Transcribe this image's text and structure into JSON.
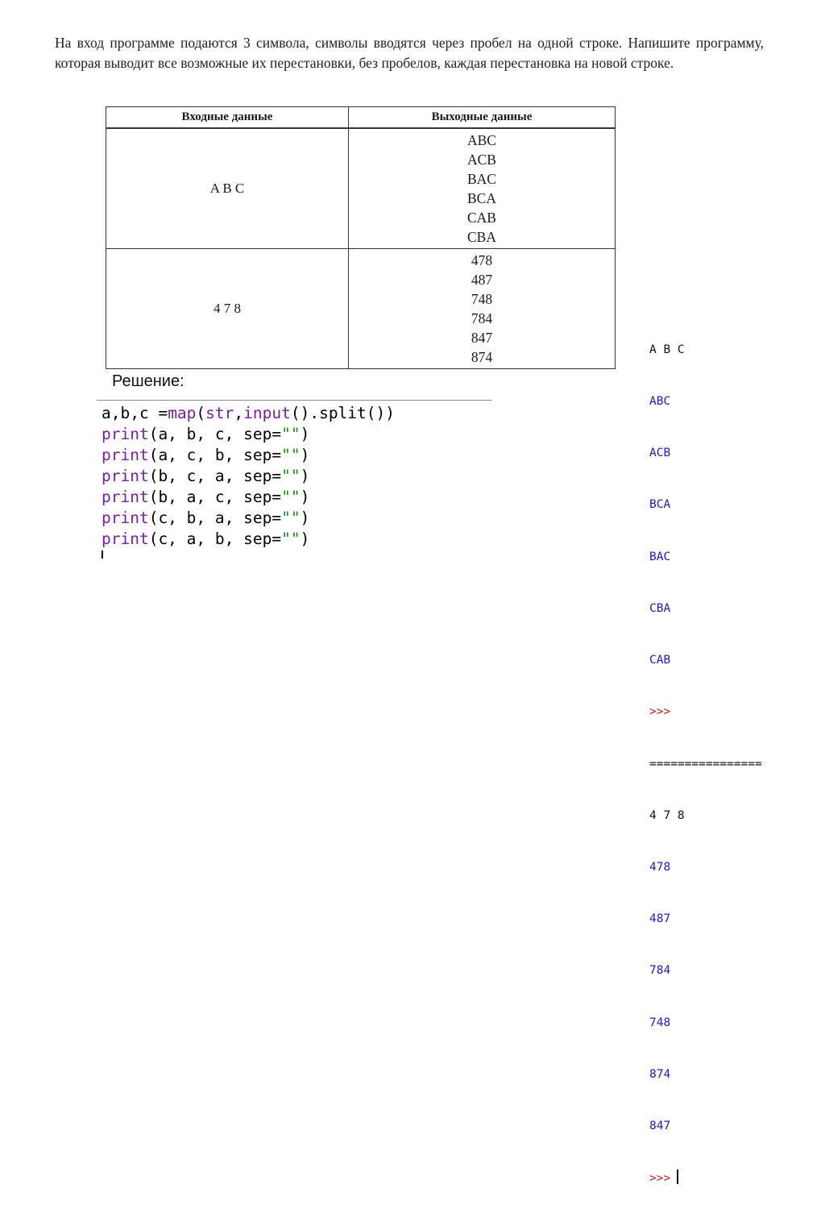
{
  "task": {
    "text": "На вход программе подаются 3 символа, символы вводятся через пробел на одной строке. Напишите программу, которая выводит все возможные их перестановки, без пробелов, каждая перестановка на новой строке."
  },
  "table": {
    "headers": [
      "Входные данные",
      "Выходные данные"
    ],
    "rows": [
      {
        "input": "A B C",
        "output": [
          "ABC",
          "ACB",
          "BAC",
          "BCA",
          "CAB",
          "CBA"
        ]
      },
      {
        "input": "4 7 8",
        "output": [
          "478",
          "487",
          "748",
          "784",
          "847",
          "874"
        ]
      }
    ]
  },
  "solution_label": "Решение:",
  "code": {
    "line1": {
      "a": "a,b,c =",
      "b": "map",
      "c": "(",
      "d": "str",
      "e": ",",
      "f": "input",
      "g": "().split())"
    },
    "print_kw": "print",
    "print_args": [
      "(a, b, c, sep=",
      "(a, c, b, sep=",
      "(b, c, a, sep=",
      "(b, a, c, sep=",
      "(c, b, a, sep=",
      "(c, a, b, sep="
    ],
    "empty_str": "\"\"",
    "close": ")"
  },
  "shell": {
    "lines": [
      {
        "text": "A B C",
        "kind": "input"
      },
      {
        "text": "ABC",
        "kind": "output"
      },
      {
        "text": "ACB",
        "kind": "output"
      },
      {
        "text": "BCA",
        "kind": "output"
      },
      {
        "text": "BAC",
        "kind": "output"
      },
      {
        "text": "CBA",
        "kind": "output"
      },
      {
        "text": "CAB",
        "kind": "output"
      },
      {
        "text": ">>>",
        "kind": "prompt"
      },
      {
        "text": "================",
        "kind": "sep"
      },
      {
        "text": "4 7 8",
        "kind": "input"
      },
      {
        "text": "478",
        "kind": "output"
      },
      {
        "text": "487",
        "kind": "output"
      },
      {
        "text": "784",
        "kind": "output"
      },
      {
        "text": "748",
        "kind": "output"
      },
      {
        "text": "874",
        "kind": "output"
      },
      {
        "text": "847",
        "kind": "output"
      },
      {
        "text": ">>>",
        "kind": "prompt"
      }
    ]
  },
  "colors": {
    "keyword": "#7a1fa2",
    "string": "#1c8c1c",
    "shell_output": "#1a1acc",
    "shell_prompt": "#c2181a"
  }
}
